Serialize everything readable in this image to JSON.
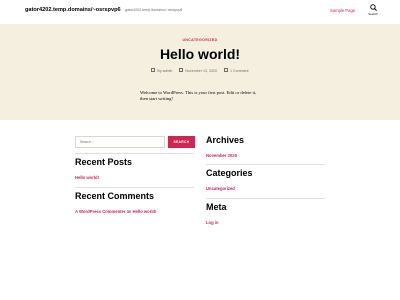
{
  "header": {
    "site_title": "gator4202.temp.domains/~osrspvp6",
    "site_description": "gator4202.temp.domains/~osrspvp6",
    "nav_link": "Sample Page",
    "search_label": "Search"
  },
  "post": {
    "category": "UNCATEGORIZED",
    "title": "Hello world!",
    "author": "By admin",
    "date": "November 13, 2020",
    "comments": "1 Comment",
    "content": "Welcome to WordPress. This is your first post. Edit or delete it, then start writing!"
  },
  "sidebar_left": {
    "search_placeholder": "Search ...",
    "search_button": "SEARCH",
    "recent_posts_title": "Recent Posts",
    "recent_post_link": "Hello world!",
    "recent_comments_title": "Recent Comments",
    "comment_author": "A WordPress Commenter",
    "comment_on": "on",
    "comment_post": "Hello world!"
  },
  "sidebar_right": {
    "archives_title": "Archives",
    "archive_link": "November 2020",
    "categories_title": "Categories",
    "category_link": "Uncategorized",
    "meta_title": "Meta",
    "meta_link": "Log in"
  },
  "colors": {
    "accent": "#cd2653",
    "hero_bg": "#f5efe0"
  }
}
